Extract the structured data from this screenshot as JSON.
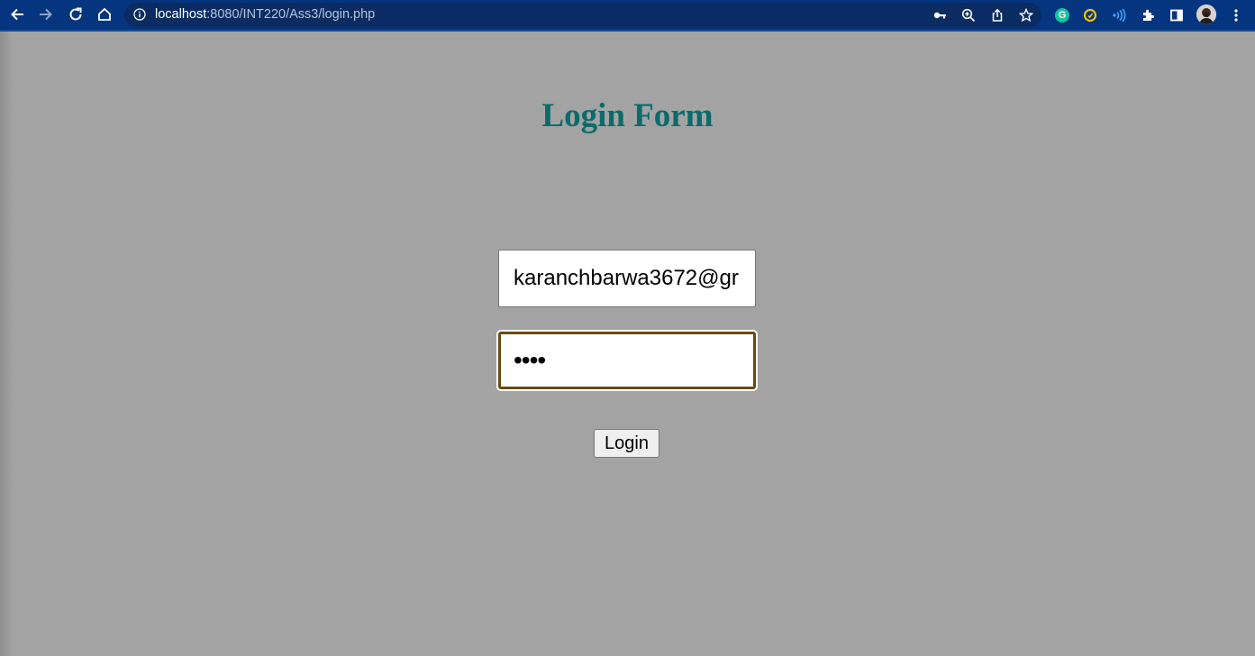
{
  "browser": {
    "url_host": "localhost",
    "url_rest": ":8080/INT220/Ass3/login.php",
    "toolbar_color": "#063580",
    "icons": [
      "back-arrow-icon",
      "forward-arrow-icon",
      "reload-icon",
      "home-icon",
      "info-icon",
      "key-icon",
      "zoom-icon",
      "share-icon",
      "star-icon",
      "grammarly-icon",
      "extension-icon",
      "wifi-extension-icon",
      "puzzle-icon",
      "side-panel-icon",
      "avatar",
      "more-vert-icon"
    ]
  },
  "page": {
    "background": "#a4a3a4",
    "title": "Login Form",
    "title_color": "#0b6b6b"
  },
  "form": {
    "email_value": "karanchbarwa3672@gr",
    "password_value": "••••",
    "login_label": "Login"
  }
}
